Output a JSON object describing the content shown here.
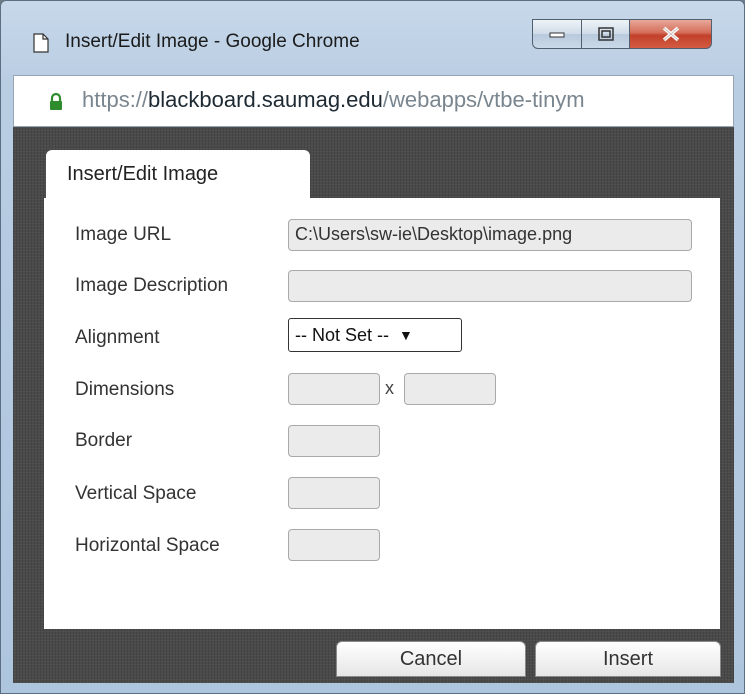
{
  "window": {
    "title": "Insert/Edit Image - Google Chrome",
    "url_scheme": "https://",
    "url_host": "blackboard.saumag.edu",
    "url_path": "/webapps/vtbe-tinym"
  },
  "dialog": {
    "tab_label": "Insert/Edit Image",
    "fields": {
      "image_url": {
        "label": "Image URL",
        "value": "C:\\Users\\sw-ie\\Desktop\\image.png"
      },
      "image_description": {
        "label": "Image Description",
        "value": ""
      },
      "alignment": {
        "label": "Alignment",
        "value": "-- Not Set --"
      },
      "dimensions": {
        "label": "Dimensions",
        "separator": "x",
        "width": "",
        "height": ""
      },
      "border": {
        "label": "Border",
        "value": ""
      },
      "vertical_space": {
        "label": "Vertical Space",
        "value": ""
      },
      "horizontal_space": {
        "label": "Horizontal Space",
        "value": ""
      }
    },
    "buttons": {
      "cancel": "Cancel",
      "insert": "Insert"
    }
  },
  "colors": {
    "close_button": "#c2402a",
    "lock": "#2e8b2e",
    "panel": "#ffffff"
  }
}
